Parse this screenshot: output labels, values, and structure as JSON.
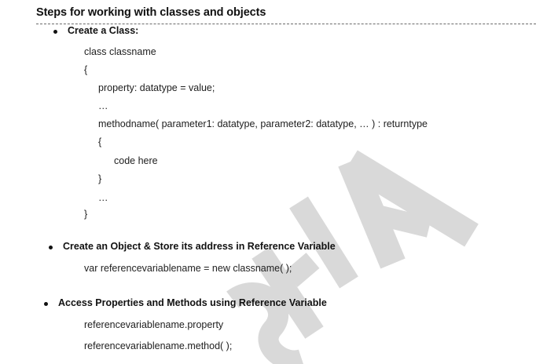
{
  "heading": "Steps for working with classes and objects",
  "sections": [
    {
      "title": "Create a Class:",
      "lines": [
        "class  classname",
        "{",
        "property: datatype = value;",
        "…",
        "methodname( parameter1: datatype, parameter2: datatype, … ) : returntype",
        "{",
        "code here",
        "}",
        "…",
        "}"
      ]
    },
    {
      "title": "Create an Object & Store its address in Reference Variable",
      "lines": [
        "var  referencevariablename = new classname( );"
      ]
    },
    {
      "title": "Access Properties and Methods using Reference Variable",
      "lines": [
        "referencevariablename.property",
        "referencevariablename.method( );"
      ]
    }
  ],
  "watermark": {
    "color": "#d9d9d9"
  }
}
